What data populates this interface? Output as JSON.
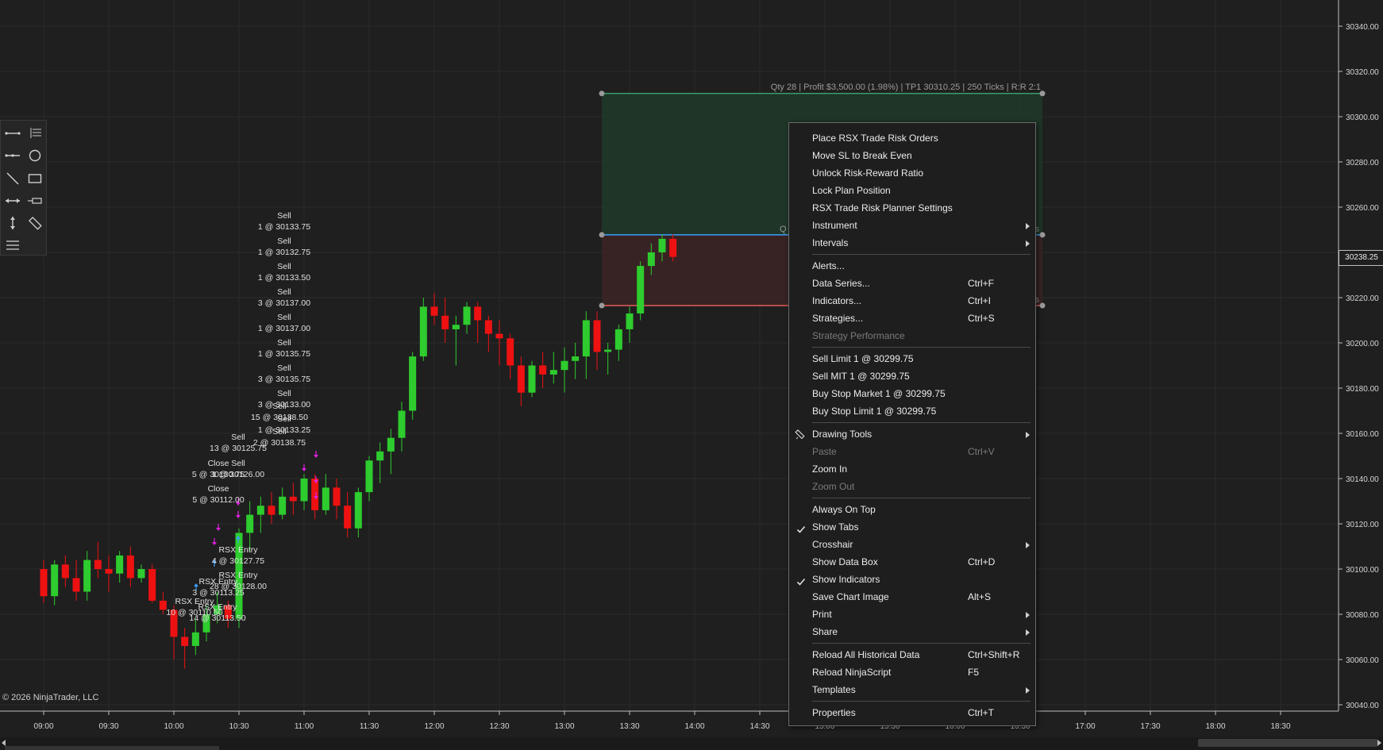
{
  "copyright": "© 2026 NinjaTrader, LLC",
  "current_price": "30238.25",
  "trade_plan": {
    "label": "Qty 28 | Profit $3,500.00 (1.98%) | TP1 30310.25 | 250 Ticks | R:R 2:1",
    "target_price": 30310.25,
    "entry_price": 30247.75,
    "stop_price": 30216.5,
    "entry_partial": "Q",
    "entry_suffix": "ks",
    "stop_suffix": "ks"
  },
  "axis": {
    "y_ticks": [
      "30340.00",
      "30320.00",
      "30300.00",
      "30280.00",
      "30260.00",
      "30240.00",
      "30220.00",
      "30200.00",
      "30180.00",
      "30160.00",
      "30140.00",
      "30120.00",
      "30100.00",
      "30080.00",
      "30060.00",
      "30040.00"
    ],
    "x_ticks": [
      "09:00",
      "09:30",
      "10:00",
      "10:30",
      "11:00",
      "11:30",
      "12:00",
      "12:30",
      "13:00",
      "13:30",
      "14:00",
      "14:30",
      "15:00",
      "15:30",
      "16:00",
      "16:30",
      "17:00",
      "17:30",
      "18:00",
      "18:30"
    ]
  },
  "chart_data": {
    "type": "candlestick",
    "ylim": [
      30036,
      30350
    ],
    "x_start": "09:00",
    "interval_min": 5,
    "candles": [
      [
        30100,
        30104,
        30085,
        30088
      ],
      [
        30088,
        30104,
        30084,
        30102
      ],
      [
        30102,
        30106,
        30092,
        30096
      ],
      [
        30096,
        30104,
        30086,
        30090
      ],
      [
        30090,
        30108,
        30086,
        30104
      ],
      [
        30104,
        30112,
        30096,
        30100
      ],
      [
        30100,
        30106,
        30090,
        30098
      ],
      [
        30098,
        30108,
        30094,
        30106
      ],
      [
        30106,
        30110,
        30092,
        30096
      ],
      [
        30096,
        30102,
        30094,
        30100
      ],
      [
        30100,
        30102,
        30085,
        30086
      ],
      [
        30086,
        30090,
        30080,
        30082
      ],
      [
        30082,
        30084,
        30060,
        30070
      ],
      [
        30070,
        30074,
        30056,
        30066
      ],
      [
        30066,
        30078,
        30062,
        30072
      ],
      [
        30072,
        30084,
        30068,
        30080
      ],
      [
        30080,
        30090,
        30076,
        30084
      ],
      [
        30084,
        30086,
        30074,
        30078
      ],
      [
        30078,
        30118,
        30074,
        30116
      ],
      [
        30116,
        30130,
        30108,
        30124
      ],
      [
        30124,
        30132,
        30116,
        30128
      ],
      [
        30128,
        30134,
        30120,
        30124
      ],
      [
        30124,
        30136,
        30122,
        30132
      ],
      [
        30132,
        30138,
        30124,
        30130
      ],
      [
        30130,
        30142,
        30126,
        30140
      ],
      [
        30140,
        30142,
        30122,
        30126
      ],
      [
        30126,
        30142,
        30124,
        30136
      ],
      [
        30136,
        30140,
        30122,
        30128
      ],
      [
        30128,
        30134,
        30114,
        30118
      ],
      [
        30118,
        30136,
        30114,
        30134
      ],
      [
        30134,
        30150,
        30130,
        30148
      ],
      [
        30148,
        30156,
        30138,
        30152
      ],
      [
        30152,
        30162,
        30142,
        30158
      ],
      [
        30158,
        30174,
        30152,
        30170
      ],
      [
        30170,
        30196,
        30166,
        30194
      ],
      [
        30194,
        30220,
        30192,
        30216
      ],
      [
        30216,
        30222,
        30208,
        30212
      ],
      [
        30212,
        30220,
        30200,
        30206
      ],
      [
        30206,
        30212,
        30190,
        30208
      ],
      [
        30208,
        30218,
        30204,
        30216
      ],
      [
        30216,
        30218,
        30200,
        30210
      ],
      [
        30210,
        30212,
        30196,
        30204
      ],
      [
        30204,
        30210,
        30190,
        30202
      ],
      [
        30202,
        30204,
        30184,
        30190
      ],
      [
        30190,
        30194,
        30172,
        30178
      ],
      [
        30178,
        30192,
        30176,
        30190
      ],
      [
        30190,
        30196,
        30180,
        30186
      ],
      [
        30186,
        30196,
        30182,
        30188
      ],
      [
        30188,
        30198,
        30178,
        30192
      ],
      [
        30192,
        30200,
        30184,
        30194
      ],
      [
        30194,
        30214,
        30184,
        30210
      ],
      [
        30210,
        30214,
        30188,
        30196
      ],
      [
        30196,
        30200,
        30186,
        30197
      ],
      [
        30197,
        30208,
        30192,
        30206
      ],
      [
        30206,
        30216,
        30200,
        30213
      ],
      [
        30213,
        30236,
        30210,
        30234
      ],
      [
        30234,
        30244,
        30230,
        30240
      ],
      [
        30240,
        30248,
        30236,
        30246
      ],
      [
        30246,
        30248,
        30236,
        30238
      ]
    ]
  },
  "executions": [
    {
      "lines": [
        "Sell",
        "1 @ 30133.75"
      ],
      "tx": 358,
      "ty": 275
    },
    {
      "lines": [
        "Sell",
        "1 @ 30132.75"
      ],
      "tx": 358,
      "ty": 307
    },
    {
      "lines": [
        "Sell",
        "1 @ 30133.50"
      ],
      "tx": 358,
      "ty": 339
    },
    {
      "lines": [
        "Sell",
        "3 @ 30137.00"
      ],
      "tx": 358,
      "ty": 371
    },
    {
      "lines": [
        "Sell",
        "1 @ 30137.00"
      ],
      "tx": 358,
      "ty": 403
    },
    {
      "lines": [
        "Sell",
        "1 @ 30135.75"
      ],
      "tx": 358,
      "ty": 435
    },
    {
      "lines": [
        "Sell",
        "3 @ 30135.75"
      ],
      "tx": 358,
      "ty": 467
    },
    {
      "lines": [
        "Sell",
        "3 @ 30133.00"
      ],
      "tx": 358,
      "ty": 499
    },
    {
      "lines": [
        "Sell",
        "15 @ 30138.50"
      ],
      "tx": 352,
      "ty": 515
    },
    {
      "lines": [
        "Sell",
        "1 @ 30133.25"
      ],
      "tx": 358,
      "ty": 531
    },
    {
      "lines": [
        "Sell",
        "2 @ 30138.75"
      ],
      "tx": 352,
      "ty": 547
    },
    {
      "lines": [
        "Sell",
        "13 @ 30125.75"
      ],
      "tx": 300,
      "ty": 554
    },
    {
      "lines": [
        "Close",
        "5 @ 30130.75"
      ],
      "tx": 275,
      "ty": 587
    },
    {
      "lines": [
        "Sell",
        "1 @ 30126.00"
      ],
      "tx": 300,
      "ty": 587
    },
    {
      "lines": [
        "Close",
        "5 @ 30112.00"
      ],
      "tx": 275,
      "ty": 619
    },
    {
      "lines": [
        "RSX Entry",
        "4 @ 30127.75"
      ],
      "tx": 300,
      "ty": 696
    },
    {
      "lines": [
        "RSX Entry",
        "3 @ 30113.25"
      ],
      "tx": 275,
      "ty": 736
    },
    {
      "lines": [
        "RSX Entry",
        "28 @ 30128.00"
      ],
      "tx": 300,
      "ty": 728
    },
    {
      "lines": [
        "RSX Entry",
        "10 @ 30110.50"
      ],
      "tx": 245,
      "ty": 761
    },
    {
      "lines": [
        "RSX Entry",
        "14 @ 30113.50"
      ],
      "tx": 274,
      "ty": 768
    }
  ],
  "context_menu": {
    "items": [
      {
        "label": "Place RSX Trade Risk Orders"
      },
      {
        "label": "Move SL to Break Even"
      },
      {
        "label": "Unlock Risk-Reward Ratio"
      },
      {
        "label": "Lock Plan Position"
      },
      {
        "label": "RSX Trade Risk Planner Settings"
      },
      {
        "label": "Instrument",
        "submenu": true
      },
      {
        "label": "Intervals",
        "submenu": true
      },
      {
        "sep": true
      },
      {
        "label": "Alerts..."
      },
      {
        "label": "Data Series...",
        "shortcut": "Ctrl+F"
      },
      {
        "label": "Indicators...",
        "shortcut": "Ctrl+I"
      },
      {
        "label": "Strategies...",
        "shortcut": "Ctrl+S"
      },
      {
        "label": "Strategy Performance",
        "disabled": true
      },
      {
        "sep": true
      },
      {
        "label": "Sell Limit 1 @ 30299.75"
      },
      {
        "label": "Sell MIT 1 @ 30299.75"
      },
      {
        "label": "Buy Stop Market 1 @ 30299.75"
      },
      {
        "label": "Buy Stop Limit 1 @ 30299.75"
      },
      {
        "sep": true
      },
      {
        "label": "Drawing Tools",
        "submenu": true,
        "icon": "pencil-icon"
      },
      {
        "label": "Paste",
        "shortcut": "Ctrl+V",
        "disabled": true
      },
      {
        "label": "Zoom In"
      },
      {
        "label": "Zoom Out",
        "disabled": true
      },
      {
        "sep": true
      },
      {
        "label": "Always On Top"
      },
      {
        "label": "Show Tabs",
        "checked": true
      },
      {
        "label": "Crosshair",
        "submenu": true
      },
      {
        "label": "Show Data Box",
        "shortcut": "Ctrl+D"
      },
      {
        "label": "Show Indicators",
        "checked": true
      },
      {
        "label": "Save Chart Image",
        "shortcut": "Alt+S"
      },
      {
        "label": "Print",
        "submenu": true
      },
      {
        "label": "Share",
        "submenu": true
      },
      {
        "sep": true
      },
      {
        "label": "Reload All Historical Data",
        "shortcut": "Ctrl+Shift+R"
      },
      {
        "label": "Reload NinjaScript",
        "shortcut": "F5"
      },
      {
        "label": "Templates",
        "submenu": true
      },
      {
        "sep": true
      },
      {
        "label": "Properties",
        "shortcut": "Ctrl+T"
      }
    ]
  },
  "drawing_tools": [
    "line-icon",
    "list-icon",
    "ray-icon",
    "ellipse-icon",
    "diagonal-line-icon",
    "rectangle-icon",
    "extended-line-icon",
    "arrow-line-icon",
    "vertical-line-icon",
    "ruler-icon",
    "menu-icon"
  ],
  "colors": {
    "bg": "#1f1f1f",
    "grid": "#2b2b2b",
    "bull": "#2ecc2e",
    "bear": "#ee1111",
    "target_zone": "#1f3a2a",
    "stop_zone": "#3a2424",
    "entry_line": "#3aa0ff",
    "stop_line": "#e85a5a",
    "target_line": "#3a9a6a"
  }
}
